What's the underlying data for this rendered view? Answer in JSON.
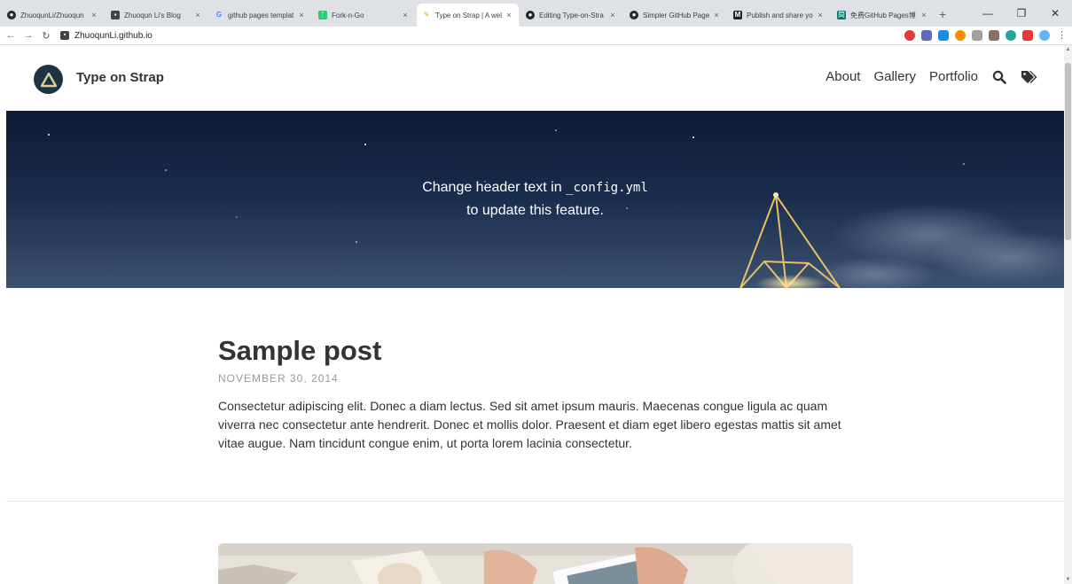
{
  "browser": {
    "tabs": [
      {
        "title": "ZhuoqunLi/Zhuoqun",
        "icon": "github-icon",
        "active": false
      },
      {
        "title": "Zhuoqun Li's Blog",
        "icon": "blog-icon",
        "active": false
      },
      {
        "title": "github pages templat",
        "icon": "google-icon",
        "active": false
      },
      {
        "title": "Fork-n-Go",
        "icon": "fork-icon",
        "active": false
      },
      {
        "title": "Type on Strap | A wel",
        "icon": "pencil-icon",
        "active": true
      },
      {
        "title": "Editing Type-on-Stra",
        "icon": "github-icon",
        "active": false
      },
      {
        "title": "Simpler GitHub Page",
        "icon": "github-icon",
        "active": false
      },
      {
        "title": "Publish and share yo",
        "icon": "medium-icon",
        "active": false
      },
      {
        "title": "免费GitHub Pages博",
        "icon": "jianshu-icon",
        "active": false
      }
    ],
    "close_glyph": "×",
    "new_tab": "+",
    "address": "ZhuoqunLi.github.io",
    "extension_colors": [
      "#e53935",
      "#5c6bc0",
      "#1e88e5",
      "#fb8c00",
      "#9e9e9e",
      "#8d6e63",
      "#26a69a",
      "#e53935",
      "#64b5f6"
    ]
  },
  "site": {
    "title": "Type on Strap",
    "nav": [
      "About",
      "Gallery",
      "Portfolio"
    ],
    "nav_icons": [
      "search-icon",
      "tags-icon"
    ],
    "hero": {
      "line1_prefix": "Change header text in ",
      "line1_code": "_config.yml",
      "line2": "to update this feature."
    },
    "post": {
      "title": "Sample post",
      "date": "NOVEMBER 30, 2014",
      "excerpt": "Consectetur adipiscing elit. Donec a diam lectus. Sed sit amet ipsum mauris. Maecenas congue ligula ac quam viverra nec consectetur ante hendrerit. Donec et mollis dolor. Praesent et diam eget libero egestas mattis sit amet vitae augue. Nam tincidunt congue enim, ut porta lorem lacinia consectetur."
    }
  }
}
